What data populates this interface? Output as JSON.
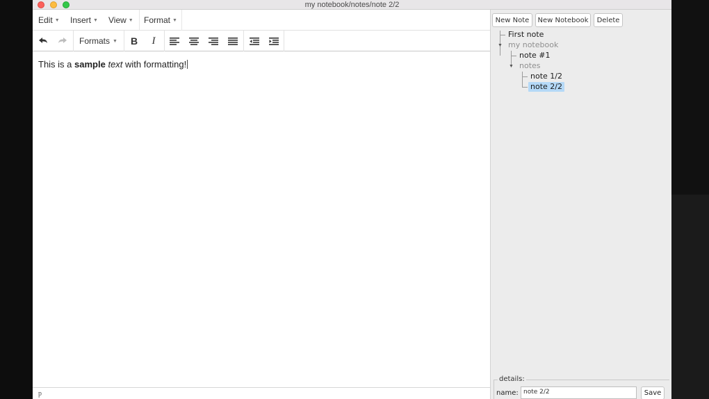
{
  "window": {
    "title": "my notebook/notes/note 2/2"
  },
  "menubar": {
    "items": [
      {
        "label": "Edit"
      },
      {
        "label": "Insert"
      },
      {
        "label": "View"
      },
      {
        "label": "Format"
      }
    ]
  },
  "toolbar": {
    "formats_label": "Formats",
    "icons": [
      "undo-icon",
      "redo-icon",
      "bold-icon",
      "italic-icon",
      "align-left-icon",
      "align-center-icon",
      "align-right-icon",
      "align-justify-icon",
      "outdent-icon",
      "indent-icon"
    ],
    "bold_glyph": "B",
    "italic_glyph": "I"
  },
  "editor": {
    "text_before": "This is a ",
    "text_bold": "sample",
    "text_space": " ",
    "text_italic": "text",
    "text_after": " with formatting!",
    "status_path": "p"
  },
  "sidebar": {
    "buttons": {
      "new_note": "New Note",
      "new_notebook": "New Notebook",
      "delete": "Delete"
    },
    "tree": {
      "first_note": "First note",
      "my_notebook": "my notebook",
      "note1": "note #1",
      "notes_folder": "notes",
      "note_1_2": "note 1/2",
      "note_2_2": "note 2/2"
    },
    "details": {
      "legend": "details:",
      "name_label": "name:",
      "name_value": "note 2/2",
      "save_label": "Save"
    }
  },
  "colors": {
    "selection": "#b5d9f7",
    "folder_text": "#8f8f8f",
    "sidebar_bg": "#ececec"
  }
}
